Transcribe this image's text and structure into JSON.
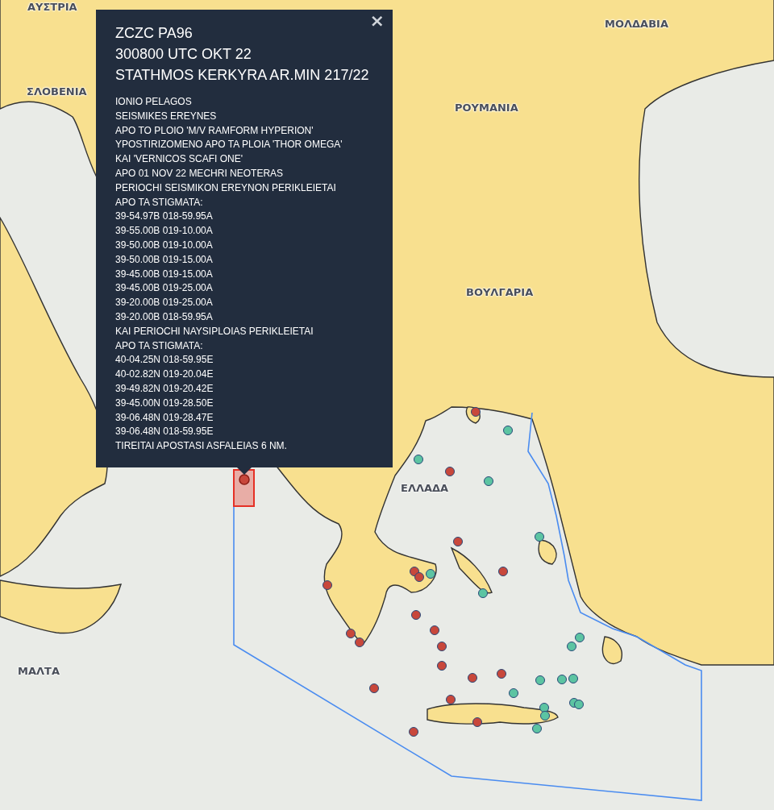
{
  "map": {
    "labels": [
      {
        "text": "ΑΥΣΤΡΙΑ"
      },
      {
        "text": "ΣΛΟΒΕΝΙΑ"
      },
      {
        "text": "ΜΟΛΔΑΒΙΑ"
      },
      {
        "text": "ΡΟΥΜΑΝΙΑ"
      },
      {
        "text": "ΒΟΥΛΓΑΡΙΑ"
      },
      {
        "text": "ΕΛΛΑΔΑ"
      },
      {
        "text": "ΜΑΛΤΑ"
      }
    ],
    "markers": [
      {
        "color": "#c8473b",
        "selected": true
      },
      {
        "color": "#c8473b",
        "selected": false
      },
      {
        "color": "#c8473b",
        "selected": false
      },
      {
        "color": "#c8473b",
        "selected": false
      },
      {
        "color": "#c8473b",
        "selected": false
      },
      {
        "color": "#c8473b",
        "selected": false
      },
      {
        "color": "#c8473b",
        "selected": false
      },
      {
        "color": "#c8473b",
        "selected": false
      },
      {
        "color": "#c8473b",
        "selected": false
      },
      {
        "color": "#c8473b",
        "selected": false
      },
      {
        "color": "#c8473b",
        "selected": false
      },
      {
        "color": "#c8473b",
        "selected": false
      },
      {
        "color": "#c8473b",
        "selected": false
      },
      {
        "color": "#c8473b",
        "selected": false
      },
      {
        "color": "#c8473b",
        "selected": false
      },
      {
        "color": "#c8473b",
        "selected": false
      },
      {
        "color": "#c8473b",
        "selected": false
      },
      {
        "color": "#c8473b",
        "selected": false
      },
      {
        "color": "#c8473b",
        "selected": false
      },
      {
        "color": "#c8473b",
        "selected": false
      },
      {
        "color": "#5cc4a2",
        "selected": false
      },
      {
        "color": "#5cc4a2",
        "selected": false
      },
      {
        "color": "#5cc4a2",
        "selected": false
      },
      {
        "color": "#5cc4a2",
        "selected": false
      },
      {
        "color": "#5cc4a2",
        "selected": false
      },
      {
        "color": "#5cc4a2",
        "selected": false
      },
      {
        "color": "#5cc4a2",
        "selected": false
      },
      {
        "color": "#5cc4a2",
        "selected": false
      },
      {
        "color": "#5cc4a2",
        "selected": false
      },
      {
        "color": "#5cc4a2",
        "selected": false
      },
      {
        "color": "#5cc4a2",
        "selected": false
      },
      {
        "color": "#5cc4a2",
        "selected": false
      },
      {
        "color": "#5cc4a2",
        "selected": false
      },
      {
        "color": "#5cc4a2",
        "selected": false
      },
      {
        "color": "#5cc4a2",
        "selected": false
      },
      {
        "color": "#5cc4a2",
        "selected": false
      },
      {
        "color": "#5cc4a2",
        "selected": false
      }
    ]
  },
  "popup": {
    "close": "×",
    "title_lines": [
      "ZCZC PA96",
      "300800 UTC OKT 22",
      "STATHMOS KERKYRA AR.MIN 217/22"
    ],
    "body_lines": [
      "IONIO PELAGOS",
      "SEISMIKES EREYNES",
      "APO TO PLOIO 'M/V RAMFORM HYPERION'",
      "YPOSTIRIZOMENO APO TA PLOIA 'THOR OMEGA'",
      "KAI 'VERNICOS SCAFI ONE'",
      "APO 01 NOV 22 MECHRI NEOTERAS",
      "PERIOCHI SEISMIKON EREYNON PERIKLEIETAI",
      "APO TA STIGMATA:",
      "39-54.97B 018-59.95A",
      "39-55.00B 019-10.00A",
      "39-50.00B 019-10.00A",
      "39-50.00B 019-15.00A",
      "39-45.00B 019-15.00A",
      "39-45.00B 019-25.00A",
      "39-20.00B 019-25.00A",
      "39-20.00B 018-59.95A",
      "KAI PERIOCHI NAYSIPLOIAS PERIKLEIETAI",
      "APO TA STIGMATA:",
      "40-04.25N 018-59.95E",
      "40-02.82N 019-20.04E",
      "39-49.82N 019-20.42E",
      "39-45.00N 019-28.50E",
      "39-06.48N 019-28.47E",
      "39-06.48N 018-59.95E",
      "TIREITAI APOSTASI ASFALEIAS 6 NM."
    ]
  }
}
